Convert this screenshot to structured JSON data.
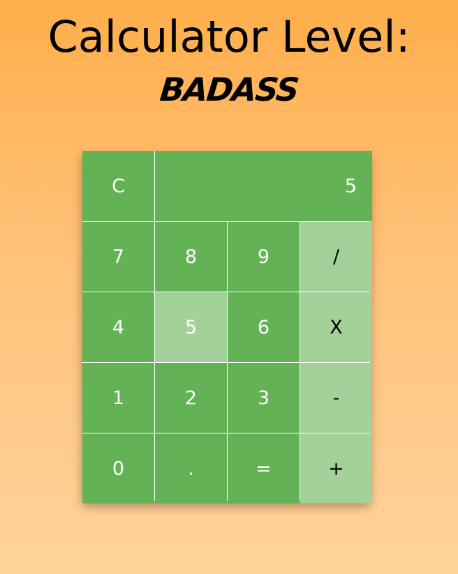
{
  "header": {
    "title": "Calculator Level:",
    "subtitle": "BADASS"
  },
  "calculator": {
    "display_value": "5",
    "keys": {
      "clear": "C",
      "seven": "7",
      "eight": "8",
      "nine": "9",
      "divide": "/",
      "four": "4",
      "five": "5",
      "six": "6",
      "multiply": "X",
      "one": "1",
      "two": "2",
      "three": "3",
      "subtract": "-",
      "zero": "0",
      "decimal": ".",
      "equals": "=",
      "add": "+"
    },
    "active_key": "five"
  },
  "colors": {
    "background_top": "#ffae4a",
    "background_bottom": "#ffd39a",
    "key_green": "#64b256",
    "key_light_green": "#a2d299",
    "key_text": "#ffffff",
    "operator_text": "#000000"
  }
}
